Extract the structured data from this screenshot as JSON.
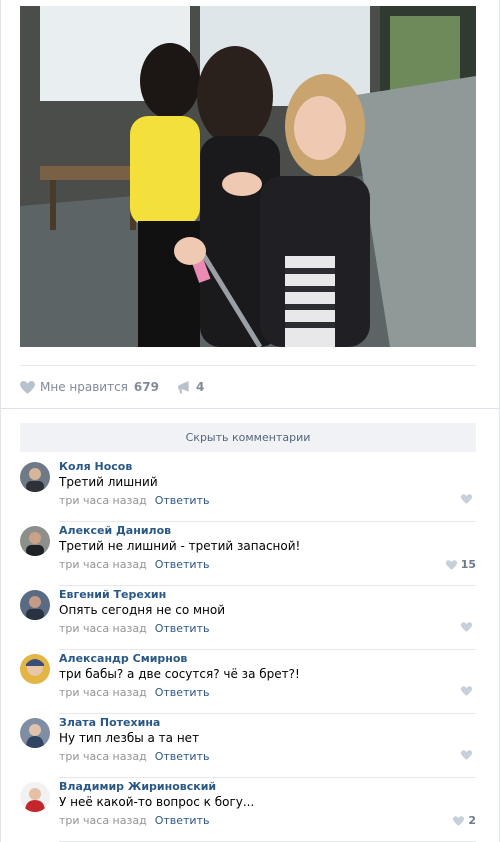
{
  "post": {
    "likes": {
      "label": "Мне нравится",
      "count": "679"
    },
    "shares": {
      "count": "4"
    }
  },
  "comments_block": {
    "hide_label": "Скрыть комментарии"
  },
  "comments": [
    {
      "author": "Коля Носов",
      "text": "Третий лишний",
      "time": "три часа назад",
      "reply": "Ответить",
      "likes": ""
    },
    {
      "author": "Алексей Данилов",
      "text": "Третий не лишний - третий запасной!",
      "time": "три часа назад",
      "reply": "Ответить",
      "likes": "15"
    },
    {
      "author": "Евгений Терехин",
      "text": "Опять сегодня не со мной",
      "time": "три часа назад",
      "reply": "Ответить",
      "likes": ""
    },
    {
      "author": "Александр Смирнов",
      "text": "три бабы? а две сосутся? чё за брет?!",
      "time": "три часа назад",
      "reply": "Ответить",
      "likes": ""
    },
    {
      "author": "Злата Потехина",
      "text": "Ну тип лезбы а та нет",
      "time": "три часа назад",
      "reply": "Ответить",
      "likes": ""
    },
    {
      "author": "Владимир Жириновский",
      "text": "У неё какой-то вопрос к богу...",
      "time": "три часа назад",
      "reply": "Ответить",
      "likes": "2"
    }
  ],
  "icons": {
    "like": "heart-icon",
    "share": "megaphone-icon"
  },
  "colors": {
    "link": "#2a5885",
    "meta": "#939393",
    "button_bg": "#f0f2f5"
  }
}
